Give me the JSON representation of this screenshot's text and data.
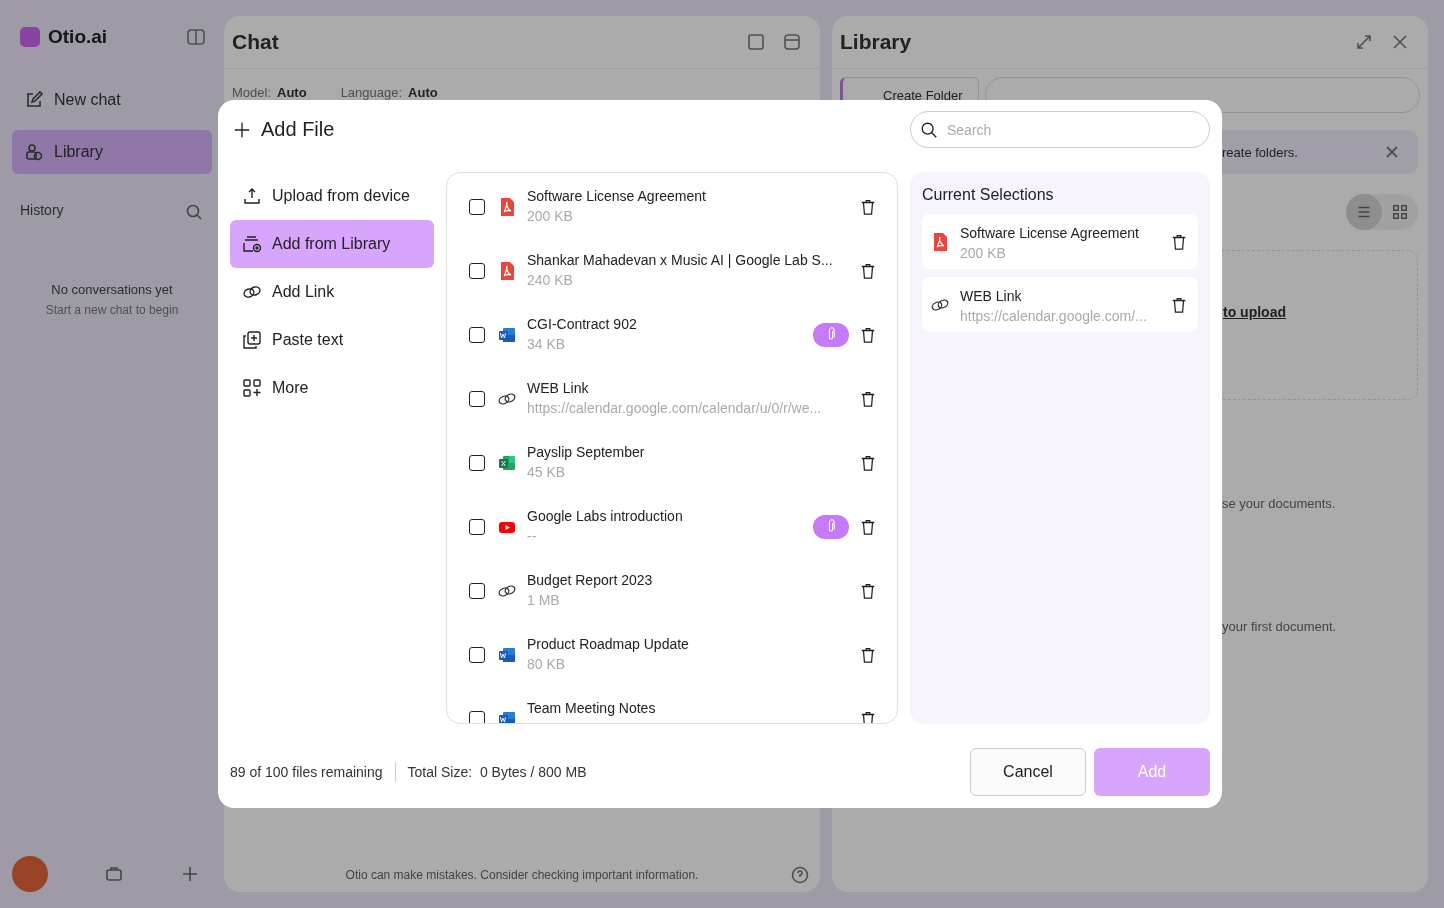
{
  "background": {
    "app_name": "Otio.ai",
    "nav": [
      {
        "label": "New chat",
        "selected": false
      },
      {
        "label": "Library",
        "selected": true
      }
    ],
    "history_label": "History",
    "empty_title": "No conversations yet",
    "empty_hint": "Start a new chat to begin",
    "chat": {
      "title": "Chat",
      "model_label": "Model:",
      "model_value": "Auto",
      "language_label": "Language:",
      "language_value": "Auto",
      "disclaimer": "Otio can make mistakes. Consider checking important information."
    },
    "library": {
      "title": "Library",
      "create_folder": "Create Folder",
      "banner": "reate folders.",
      "view_options": [
        {
          "kind": "list",
          "selected": true
        },
        {
          "kind": "grid",
          "selected": false
        }
      ],
      "upload_link": "to upload",
      "hint_1": "se your documents.",
      "hint_2": "your first document."
    }
  },
  "dialog": {
    "title": "Add File",
    "search": {
      "placeholder": "Search"
    },
    "menu": [
      {
        "label": "Upload from device",
        "selected": false
      },
      {
        "label": "Add from Library",
        "selected": true
      },
      {
        "label": "Add Link",
        "selected": false
      },
      {
        "label": "Paste text",
        "selected": false
      },
      {
        "label": "More",
        "selected": false
      }
    ],
    "files": [
      {
        "name": "Software License Agreement",
        "size": "200 KB",
        "kind": "pdf",
        "checked": false,
        "attached": false
      },
      {
        "name": "Shankar Mahadevan x Music AI | Google Lab S...",
        "size": "240 KB",
        "kind": "pdf",
        "checked": false,
        "attached": false
      },
      {
        "name": "CGI-Contract 902",
        "size": "34 KB",
        "kind": "word",
        "checked": false,
        "attached": true
      },
      {
        "name": "WEB Link",
        "size": "https://calendar.google.com/calendar/u/0/r/we...",
        "kind": "link",
        "checked": false,
        "attached": false
      },
      {
        "name": "Payslip September",
        "size": "45 KB",
        "kind": "excel",
        "checked": false,
        "attached": false
      },
      {
        "name": "Google Labs introduction",
        "size": "--",
        "kind": "youtube",
        "checked": false,
        "attached": true
      },
      {
        "name": "Budget Report 2023",
        "size": "1 MB",
        "kind": "link",
        "checked": false,
        "attached": false
      },
      {
        "name": "Product Roadmap Update",
        "size": "80 KB",
        "kind": "word",
        "checked": false,
        "attached": false
      },
      {
        "name": "Team Meeting Notes",
        "kind": "word",
        "checked": false,
        "attached": false
      }
    ],
    "selections_title": "Current Selections",
    "selections": [
      {
        "name": "Software License Agreement",
        "size": "200 KB",
        "kind": "pdf"
      },
      {
        "name": "WEB Link",
        "size": "https://calendar.google.com/...",
        "kind": "link"
      }
    ],
    "files_remaining": "89 of 100 files remaining",
    "total_size": "Total Size:  0 Bytes / 800 MB",
    "buttons": {
      "cancel": "Cancel",
      "add": "Add"
    }
  }
}
